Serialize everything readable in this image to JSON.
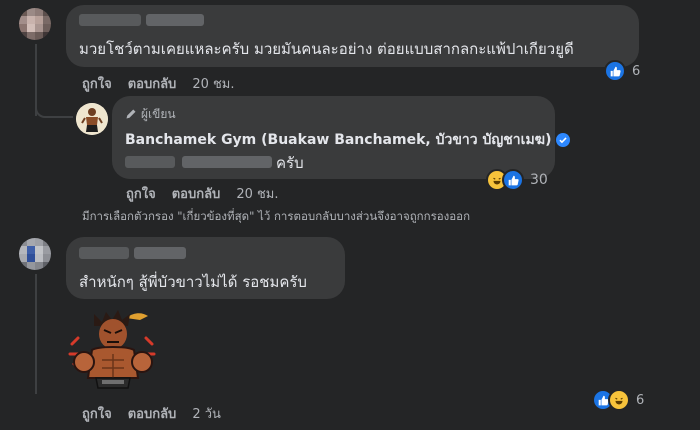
{
  "comments": [
    {
      "text": "มวยโชว์ตามเคยแหละครับ มวยมันคนละอย่าง ต่อยแบบสากลกะแพ้ปาเกียวยูดี",
      "like_label": "ถูกใจ",
      "reply_label": "ตอบกลับ",
      "time": "20 ชม.",
      "reaction_count": "6",
      "reaction_icons": [
        "like-icon"
      ]
    },
    {
      "text": "สำหนักๆ สู้พี่บัวขาวไม่ได้ รอชมครับ",
      "like_label": "ถูกใจ",
      "reply_label": "ตอบกลับ",
      "time": "2 วัน",
      "reaction_count": "6",
      "reaction_icons": [
        "like-icon",
        "haha-icon"
      ]
    }
  ],
  "reply": {
    "author_tag": "ผู้เขียน",
    "author_name": "Banchamek Gym (Buakaw Banchamek, บัวขาว บัญชาเมฆ)",
    "text_suffix": "ครับ",
    "like_label": "ถูกใจ",
    "reply_label": "ตอบกลับ",
    "time": "20 ชม.",
    "reaction_count": "30",
    "reaction_icons": [
      "haha-icon",
      "like-icon"
    ]
  },
  "filter_note": "มีการเลือกตัวกรอง \"เกี่ยวข้องที่สุด\" ไว้ การตอบกลับบางส่วนจึงอาจถูกกรองออก",
  "colors": {
    "background": "#242526",
    "bubble": "#3a3b3c",
    "like_blue": "#1b74e4",
    "haha_yellow": "#f7c33b",
    "verified_blue": "#2d88ff"
  }
}
